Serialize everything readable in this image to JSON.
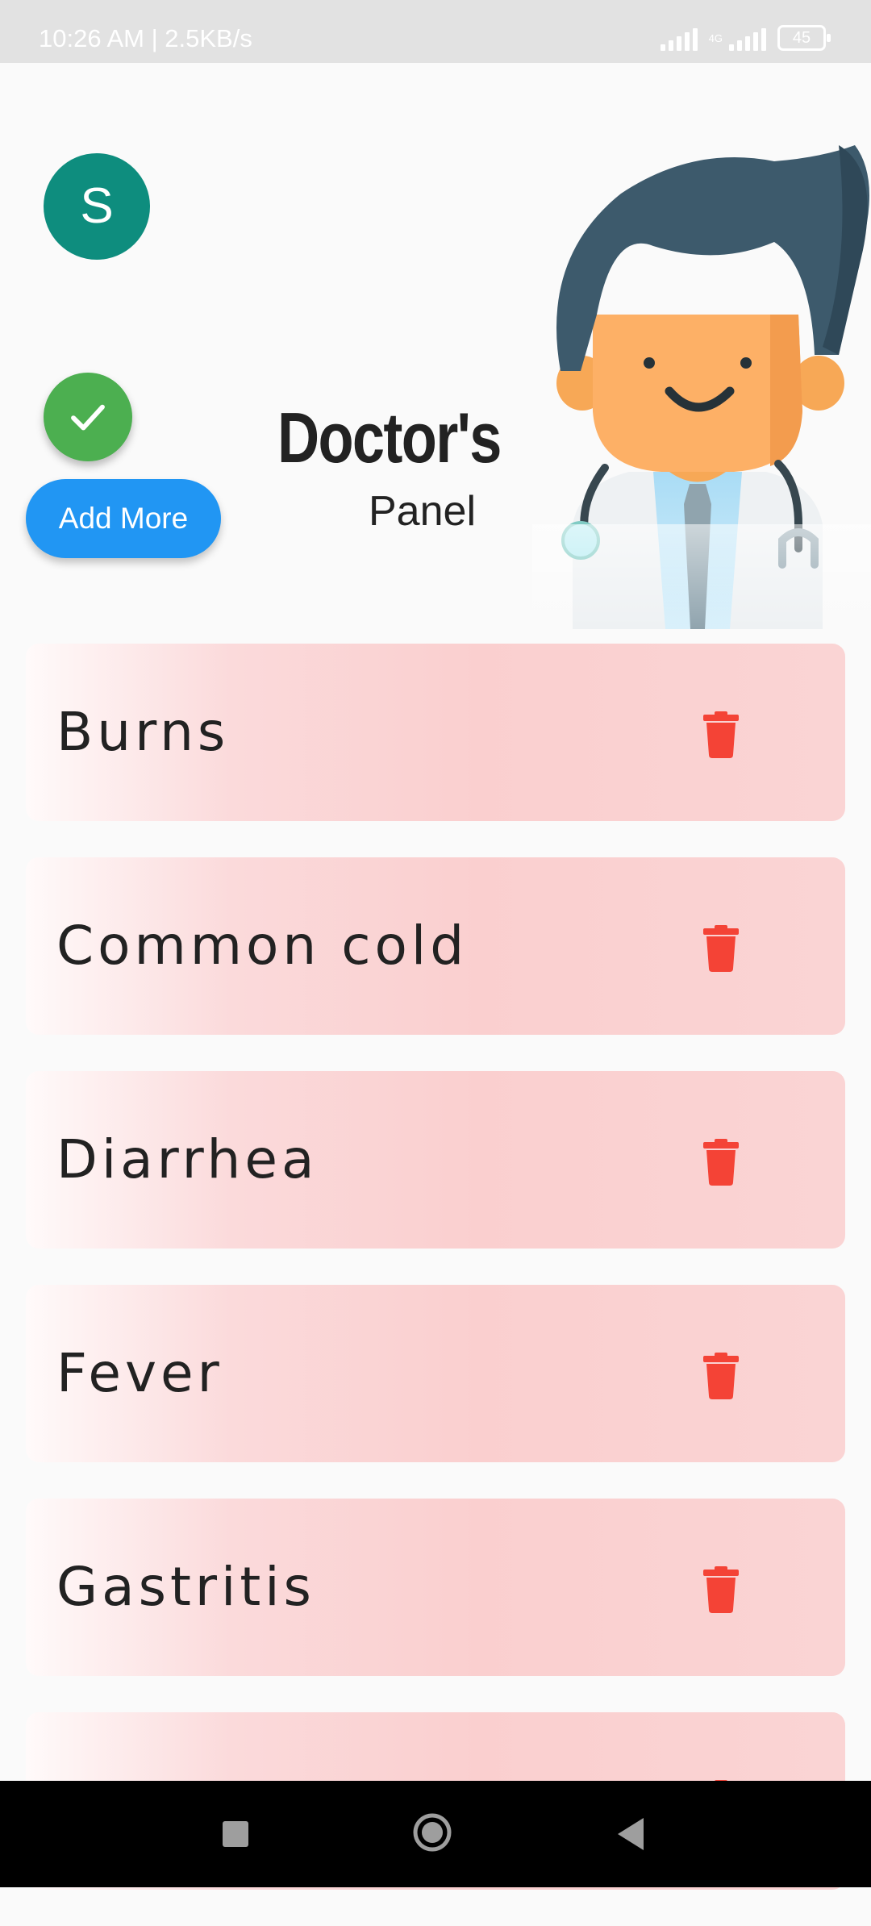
{
  "status": {
    "time_speed": "10:26 AM | 2.5KB/s",
    "network": "4G",
    "battery": "45"
  },
  "header": {
    "avatar_letter": "S",
    "add_more_label": "Add More",
    "title": "Doctor's",
    "subtitle": "Panel"
  },
  "diseases": [
    {
      "name": "Burns"
    },
    {
      "name": "Common cold"
    },
    {
      "name": "Diarrhea"
    },
    {
      "name": "Fever"
    },
    {
      "name": "Gastritis"
    },
    {
      "name": ""
    }
  ],
  "colors": {
    "avatar": "#0e8d7e",
    "check": "#4caf50",
    "add_more": "#2196f3",
    "delete": "#f44336",
    "card_tint": "#facfcf"
  }
}
